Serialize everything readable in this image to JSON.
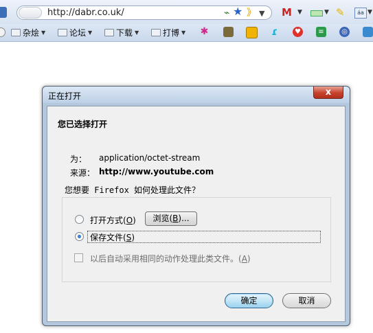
{
  "browser": {
    "url": "http://dabr.co.uk/",
    "bookmarks": [
      "杂烩",
      "论坛",
      "下载",
      "打博"
    ]
  },
  "dialog": {
    "title": "正在打开",
    "close_glyph": "x",
    "heading": "您已选择打开",
    "type_label": "为：",
    "type_value": "application/octet-stream",
    "source_label": "来源：",
    "source_value": "http://www.youtube.com",
    "question_prefix": "您想要",
    "question_app": " Firefox ",
    "question_suffix": "如何处理此文件？",
    "open_with_text": "打开方式(",
    "open_with_key": "O",
    "browse_text": "浏览(",
    "browse_key": "B",
    "browse_suffix": ")...",
    "save_text": "保存文件(",
    "save_key": "S",
    "auto_text": "以后自动采用相同的动作处理此类文件。(",
    "auto_key": "A",
    "close_paren": ")",
    "ok_label": "确定",
    "cancel_label": "取消",
    "selected_option": "save"
  },
  "colors": {
    "ok_border": "#2c628b",
    "close_red": "#c7422b",
    "title_bar": "#bcd0e6"
  }
}
